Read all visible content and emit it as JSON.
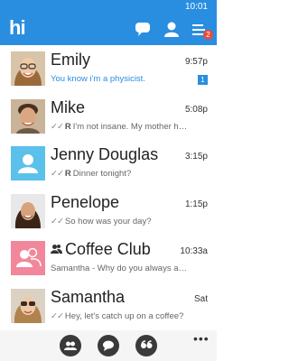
{
  "status_bar": {
    "time": "10:01"
  },
  "header": {
    "logo": "hi",
    "icons": [
      "chat-icon",
      "user-icon",
      "menu-icon"
    ],
    "menu_badge": "2"
  },
  "colors": {
    "accent": "#2a8ee0",
    "badge": "#e64c3c",
    "group_avatar": "#f2879b",
    "placeholder_avatar": "#5bc0ea"
  },
  "chats": [
    {
      "name": "Emily",
      "time": "9:57p",
      "preview": "You know i'm a physicist.",
      "unread": "1",
      "avatar": "photo"
    },
    {
      "name": "Mike",
      "time": "5:08p",
      "status_ticks": "✓✓",
      "status_mark": "R",
      "preview": "I'm not insane. My mother had...",
      "avatar": "photo"
    },
    {
      "name": "Jenny Douglas",
      "time": "3:15p",
      "status_ticks": "✓✓",
      "status_mark": "R",
      "preview": "Dinner tonight?",
      "avatar": "placeholder"
    },
    {
      "name": "Penelope",
      "time": "1:15p",
      "status_ticks": "✓✓",
      "preview": "So how was your day?",
      "avatar": "photo"
    },
    {
      "name": "Coffee Club",
      "time": "10:33a",
      "preview": "Samantha - Why do you always add...",
      "avatar": "group"
    },
    {
      "name": "Samantha",
      "time": "Sat",
      "status_ticks": "✓✓",
      "preview": "Hey, let's catch up on a coffee?",
      "avatar": "photo"
    }
  ],
  "bottom_bar": {
    "buttons": [
      "group-chat-icon",
      "new-chat-icon",
      "quote-icon"
    ],
    "more": "•••"
  }
}
